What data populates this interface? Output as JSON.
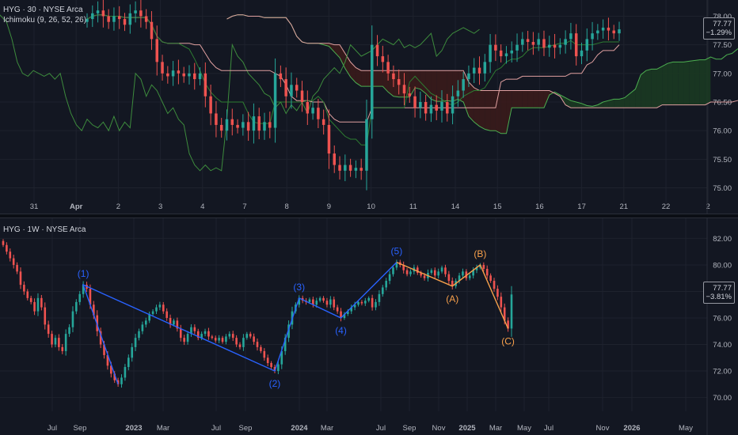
{
  "top_chart": {
    "title": "HYG · 30 · NYSE Arca",
    "indicator": "Ichimoku (9, 26, 52, 26)",
    "price_label": "77.77",
    "change_label": "−1.29%"
  },
  "bottom_chart": {
    "title": "HYG · 1W · NYSE Arca",
    "price_label": "77.77",
    "change_label": "−3.81%"
  },
  "colors": {
    "background": "#131722",
    "grid": "#1e222d",
    "up": "#26a69a",
    "down": "#ef5350",
    "wave_blue": "#2962ff",
    "wave_orange": "#f7a04b",
    "tenkan": "#2e7d32",
    "kijun": "#e0a0a0",
    "chikou": "#3d8b3d",
    "cloud_bull": "#1b3a22",
    "cloud_bear": "#3a1b1b"
  },
  "chart_data": [
    {
      "type": "candlestick",
      "title": "HYG · 30 · NYSE Arca",
      "indicator": "Ichimoku (9, 26, 52, 26)",
      "x_ticks": [
        "31",
        "Apr",
        "2",
        "3",
        "4",
        "7",
        "8",
        "9",
        "10",
        "11",
        "14",
        "15",
        "16",
        "17",
        "21",
        "22",
        "2"
      ],
      "y_ticks": [
        75.0,
        75.5,
        76.0,
        76.5,
        77.0,
        77.5,
        78.0
      ],
      "ylim": [
        74.8,
        78.2
      ],
      "last_price": 77.77,
      "change_pct": -1.29,
      "close_series": [
        77.95,
        78.05,
        78.1,
        78.0,
        77.9,
        78.0,
        77.95,
        77.85,
        78.05,
        78.1,
        78.0,
        77.9,
        77.6,
        77.2,
        77.0,
        76.95,
        77.05,
        77.0,
        76.95,
        77.0,
        76.9,
        77.0,
        76.6,
        76.3,
        76.1,
        76.0,
        76.2,
        76.1,
        76.05,
        76.15,
        76.0,
        76.25,
        76.0,
        76.15,
        76.05,
        77.0,
        76.9,
        76.6,
        76.8,
        76.7,
        76.5,
        76.3,
        76.4,
        76.2,
        76.1,
        75.6,
        75.4,
        75.3,
        75.4,
        75.3,
        75.35,
        75.3,
        76.2,
        77.5,
        77.3,
        77.2,
        77.0,
        76.9,
        76.8,
        76.65,
        76.6,
        76.4,
        76.5,
        76.3,
        76.45,
        76.35,
        76.5,
        76.3,
        76.6,
        76.7,
        76.9,
        77.0,
        77.1,
        77.0,
        77.2,
        77.5,
        77.4,
        77.3,
        77.35,
        77.4,
        77.5,
        77.6,
        77.55,
        77.5,
        77.6,
        77.45,
        77.5,
        77.45,
        77.5,
        77.6,
        77.7,
        77.3,
        77.4,
        77.6,
        77.7,
        77.75,
        77.8,
        77.75,
        77.7,
        77.77
      ]
    },
    {
      "type": "candlestick",
      "title": "HYG · 1W · NYSE Arca",
      "x_ticks": [
        "Jul",
        "Sep",
        "2023",
        "Mar",
        "Jul",
        "Sep",
        "2024",
        "Mar",
        "Jul",
        "Sep",
        "Nov",
        "2025",
        "Mar",
        "May",
        "Jul",
        "Nov",
        "2026",
        "May"
      ],
      "y_ticks": [
        70.0,
        72.0,
        74.0,
        76.0,
        78.0,
        80.0,
        82.0
      ],
      "ylim": [
        69.2,
        82.8
      ],
      "last_price": 77.77,
      "change_pct": -3.81,
      "close_series": [
        81.5,
        81.0,
        80.5,
        80.0,
        79.5,
        78.5,
        78.0,
        77.5,
        77.2,
        76.5,
        77.5,
        76.8,
        75.5,
        74.8,
        74.0,
        74.5,
        73.8,
        73.5,
        74.8,
        75.3,
        76.5,
        77.2,
        77.8,
        78.5,
        78.2,
        77.0,
        76.2,
        75.0,
        74.0,
        73.2,
        72.4,
        71.8,
        71.3,
        71.0,
        71.5,
        72.3,
        73.0,
        73.8,
        74.5,
        75.0,
        75.5,
        75.8,
        76.3,
        76.5,
        76.8,
        77.0,
        76.5,
        76.0,
        75.5,
        75.8,
        75.2,
        74.5,
        74.2,
        74.8,
        75.3,
        75.0,
        74.5,
        74.8,
        75.0,
        74.6,
        74.5,
        74.3,
        74.5,
        74.2,
        74.6,
        74.8,
        74.5,
        74.0,
        73.8,
        74.5,
        74.8,
        74.6,
        74.2,
        73.8,
        73.5,
        73.0,
        72.6,
        72.3,
        72.0,
        72.5,
        73.5,
        74.5,
        75.5,
        76.5,
        77.0,
        77.5,
        77.3,
        77.2,
        77.4,
        77.0,
        77.3,
        77.5,
        77.3,
        77.0,
        77.4,
        76.8,
        76.5,
        76.0,
        76.3,
        76.5,
        76.8,
        77.0,
        77.2,
        77.1,
        77.3,
        77.5,
        76.8,
        77.2,
        77.8,
        78.3,
        78.8,
        79.3,
        79.8,
        80.2,
        80.0,
        79.6,
        79.3,
        79.5,
        79.8,
        79.4,
        79.2,
        79.0,
        79.4,
        79.6,
        79.2,
        79.5,
        79.8,
        79.3,
        78.8,
        78.4,
        78.8,
        79.2,
        79.5,
        79.0,
        79.2,
        79.6,
        79.8,
        80.0,
        79.7,
        79.2,
        78.8,
        78.2,
        77.6,
        76.8,
        75.8,
        75.2,
        77.77
      ],
      "elliott_waves": [
        {
          "label": "(1)",
          "color": "blue"
        },
        {
          "label": "(2)",
          "color": "blue"
        },
        {
          "label": "(3)",
          "color": "blue"
        },
        {
          "label": "(4)",
          "color": "blue"
        },
        {
          "label": "(5)",
          "color": "blue"
        },
        {
          "label": "(A)",
          "color": "orange"
        },
        {
          "label": "(B)",
          "color": "orange"
        },
        {
          "label": "(C)",
          "color": "orange"
        }
      ]
    }
  ]
}
